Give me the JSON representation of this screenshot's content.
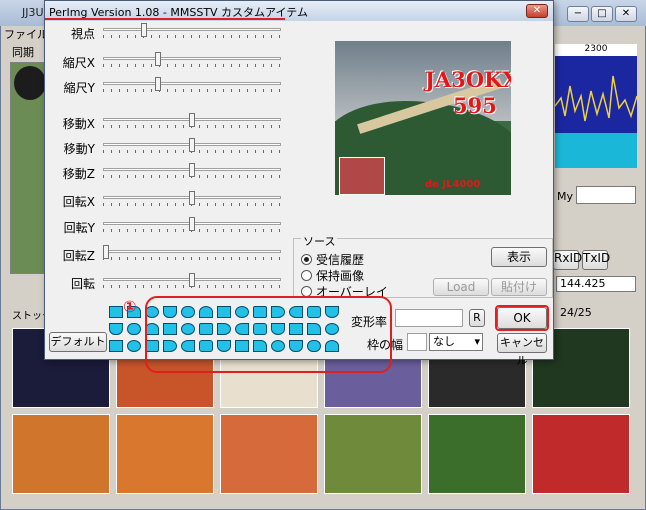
{
  "main": {
    "title": "JJ3U",
    "menu_label": "ファイル",
    "tab_label": "同期",
    "freq_scale": "2300",
    "my_label": "My",
    "rx_label": "RxID",
    "tx_label": "TxID",
    "freq_value": "144.425",
    "page_counter": "24/25",
    "stock_label": "ストック画"
  },
  "dialog": {
    "title": "PerImg Version 1.08  -  MMSSTV カスタムアイテム",
    "close_label": "✕",
    "sliders": [
      {
        "label": "視点",
        "value": 0.22
      },
      {
        "label": "縮尺X",
        "value": 0.3
      },
      {
        "label": "縮尺Y",
        "value": 0.3
      },
      {
        "label": "移動X",
        "value": 0.5
      },
      {
        "label": "移動Y",
        "value": 0.5
      },
      {
        "label": "移動Z",
        "value": 0.5
      },
      {
        "label": "回転X",
        "value": 0.5
      },
      {
        "label": "回転Y",
        "value": 0.5
      },
      {
        "label": "回転Z",
        "value": 0.0
      },
      {
        "label": "回転",
        "value": 0.5
      }
    ],
    "preview": {
      "callsign": "JA3OKX",
      "rst": "595",
      "tag": "de JL4000"
    },
    "source": {
      "legend": "ソース",
      "options": [
        {
          "label": "受信履歴",
          "checked": true
        },
        {
          "label": "保持画像",
          "checked": false
        },
        {
          "label": "オーバーレイ",
          "checked": false
        }
      ],
      "show_button": "表示",
      "load_button": "Load",
      "paste_button": "貼付け"
    },
    "annotation_number": "①",
    "default_button": "デフォルト",
    "henkei_label": "変形率",
    "henkei_r": "R",
    "waku_label": "枠の幅",
    "waku_value": "なし",
    "ok_button": "OK",
    "cancel_button": "キャンセル"
  },
  "colors": {
    "highlight": "#e02020",
    "shape_fill": "#23c0e8",
    "callsign": "#e21818"
  }
}
